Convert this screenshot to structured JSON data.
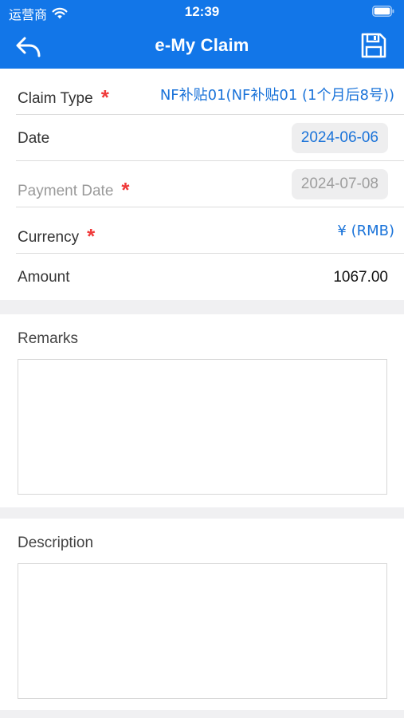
{
  "status_bar": {
    "carrier": "运营商",
    "time": "12:39"
  },
  "nav": {
    "title": "e-My Claim",
    "back_icon": "back-arrow-icon",
    "save_icon": "floppy-save-icon"
  },
  "form": {
    "claim_type": {
      "label": "Claim Type",
      "required": "*",
      "value": "NF补贴01(NF补贴01 (1个月后8号))"
    },
    "date": {
      "label": "Date",
      "value": "2024-06-06"
    },
    "payment_date": {
      "label": "Payment Date",
      "required": "*",
      "value": "2024-07-08"
    },
    "currency": {
      "label": "Currency",
      "required": "*",
      "value": "¥ (RMB)"
    },
    "amount": {
      "label": "Amount",
      "value": "1067.00"
    }
  },
  "remarks": {
    "label": "Remarks",
    "value": ""
  },
  "description": {
    "label": "Description",
    "value": ""
  },
  "colors": {
    "brand_blue": "#1276e8",
    "link_blue": "#1a73d9",
    "required_red": "#f03a3a"
  }
}
